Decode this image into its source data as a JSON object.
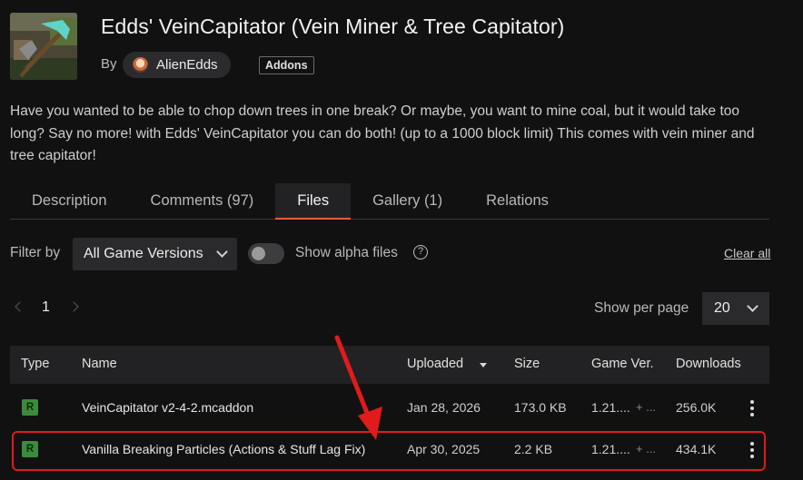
{
  "project": {
    "title": "Edds' VeinCapitator (Vein Miner & Tree Capitator)",
    "by_label": "By",
    "author": "AlienEdds",
    "category_tag": "Addons",
    "description": "Have you wanted to be able to chop down trees in one break? Or maybe, you want to mine coal, but it would take too long? Say no more! with Edds' VeinCapitator you can do both! (up to a 1000 block limit) This comes with vein miner and tree capitator!"
  },
  "tabs": [
    {
      "label": "Description",
      "active": false
    },
    {
      "label": "Comments (97)",
      "active": false
    },
    {
      "label": "Files",
      "active": true
    },
    {
      "label": "Gallery (1)",
      "active": false
    },
    {
      "label": "Relations",
      "active": false
    }
  ],
  "filters": {
    "filter_by_label": "Filter by",
    "game_versions_selected": "All Game Versions",
    "alpha_toggle_label": "Show alpha files",
    "alpha_toggle_on": false,
    "clear_all_label": "Clear all"
  },
  "pagination": {
    "current_page": "1",
    "show_per_page_label": "Show per page",
    "per_page_value": "20"
  },
  "table": {
    "headers": {
      "type": "Type",
      "name": "Name",
      "uploaded": "Uploaded",
      "size": "Size",
      "game_ver": "Game Ver.",
      "downloads": "Downloads"
    },
    "rows": [
      {
        "type_badge": "R",
        "name": "VeinCapitator v2-4-2.mcaddon",
        "uploaded": "Jan 28, 2026",
        "size": "173.0 KB",
        "game_ver": "1.21....",
        "game_ver_more": "+ ...",
        "downloads": "256.0K"
      },
      {
        "type_badge": "R",
        "name": "Vanilla Breaking Particles (Actions & Stuff Lag Fix)",
        "uploaded": "Apr 30, 2025",
        "size": "2.2 KB",
        "game_ver": "1.21....",
        "game_ver_more": "+ ...",
        "downloads": "434.1K",
        "highlighted": true
      }
    ]
  },
  "colors": {
    "background": "#111112",
    "tab_active_underline": "#f05c34",
    "release_badge": "#3c8b3c",
    "annotation_red": "#e11b1b"
  }
}
